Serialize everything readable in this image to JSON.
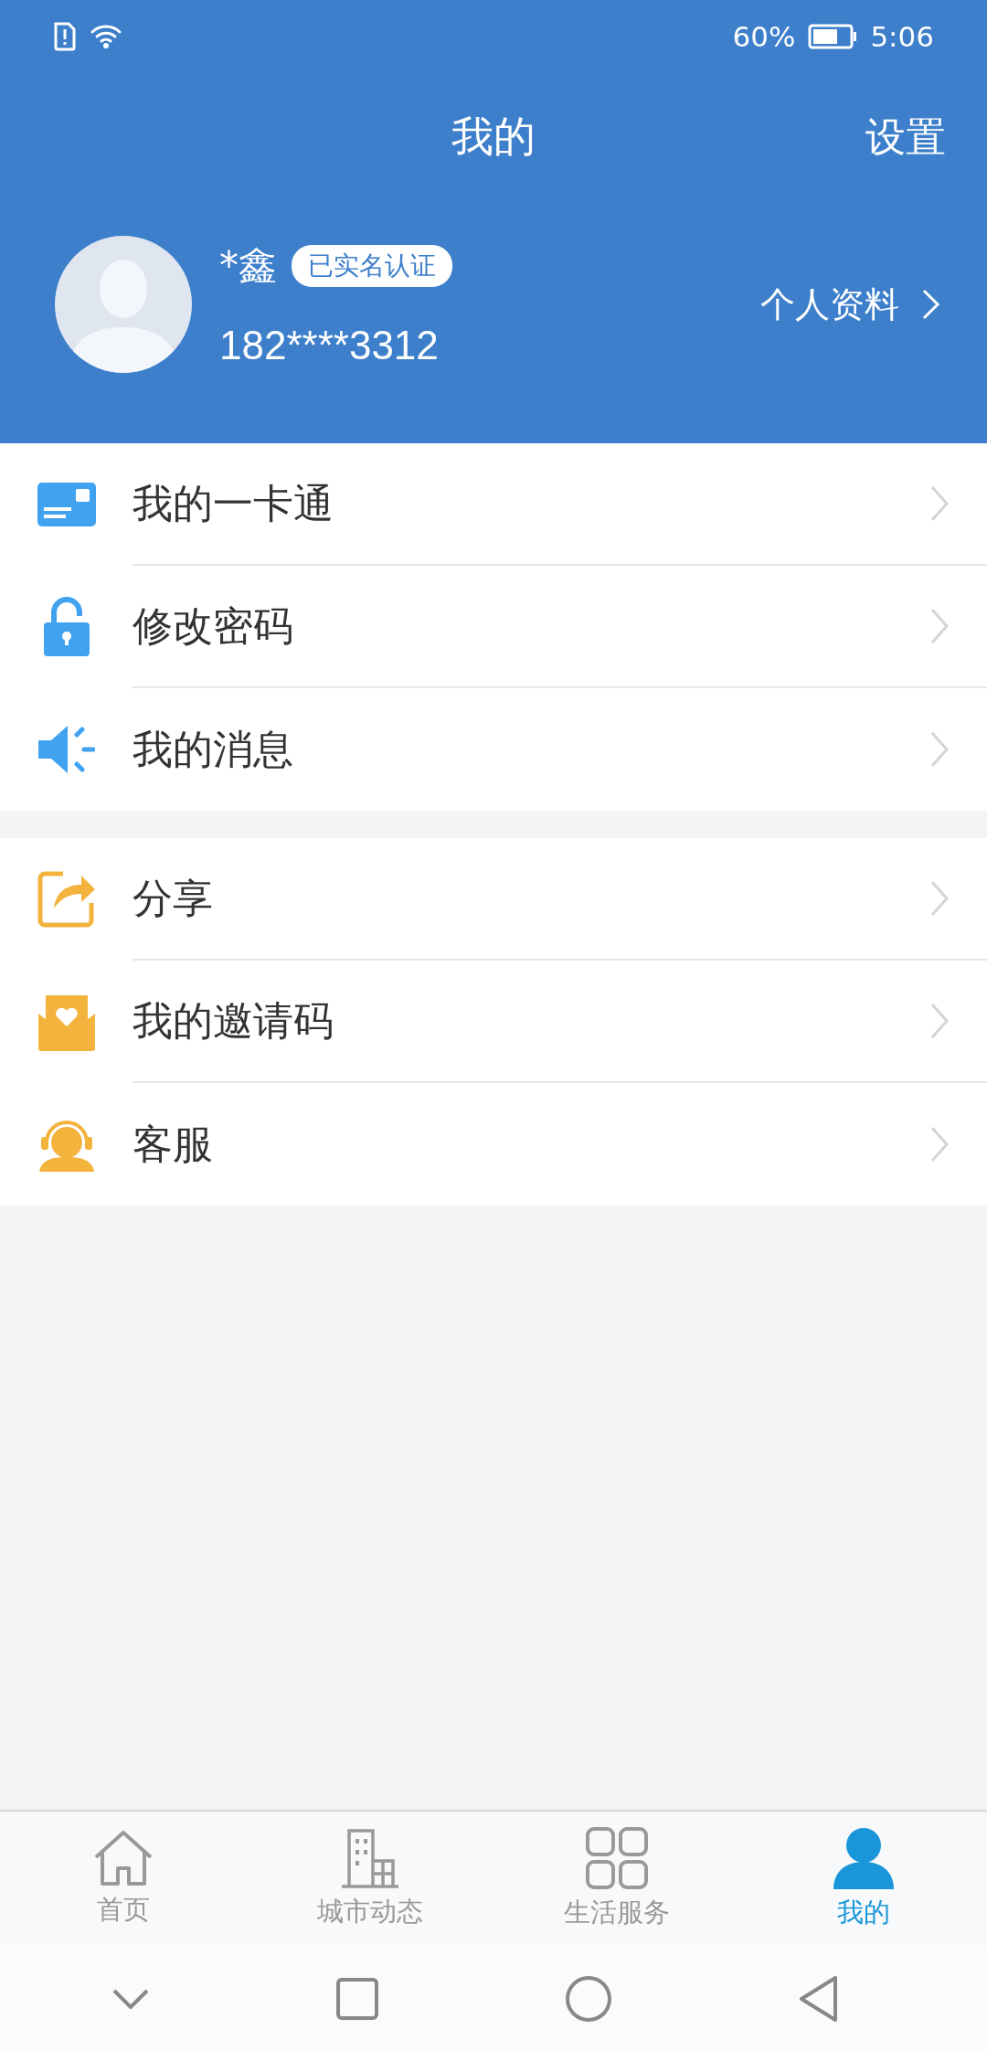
{
  "status_bar": {
    "battery_percent": "60%",
    "time": "5:06"
  },
  "header": {
    "title": "我的",
    "action": "设置"
  },
  "profile": {
    "name": "*鑫",
    "badge": "已实名认证",
    "phone": "182****3312",
    "link": "个人资料"
  },
  "menu_groups": [
    {
      "items": [
        {
          "kind": "card",
          "label": "我的一卡通"
        },
        {
          "kind": "lock",
          "label": "修改密码"
        },
        {
          "kind": "speaker",
          "label": "我的消息"
        }
      ]
    },
    {
      "items": [
        {
          "kind": "share",
          "label": "分享"
        },
        {
          "kind": "invite",
          "label": "我的邀请码"
        },
        {
          "kind": "service",
          "label": "客服"
        }
      ]
    }
  ],
  "tab_bar": [
    {
      "kind": "home",
      "label": "首页",
      "selected": false
    },
    {
      "kind": "city",
      "label": "城市动态",
      "selected": false
    },
    {
      "kind": "grid",
      "label": "生活服务",
      "selected": false
    },
    {
      "kind": "person",
      "label": "我的",
      "selected": true
    }
  ]
}
